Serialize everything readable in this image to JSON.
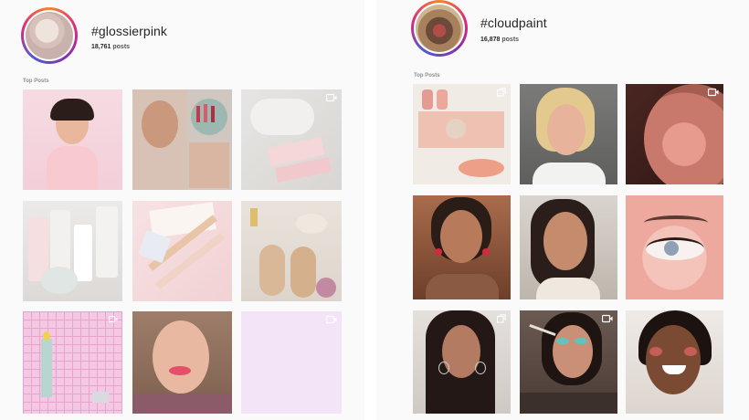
{
  "left": {
    "hashtag": "#glossierpink",
    "post_count": "18,761",
    "post_count_suffix": "posts",
    "section_label": "Top Posts",
    "avatar_icon": "avatar-photo",
    "tiles": [
      {
        "name": "post-1",
        "desc": "portrait-pink",
        "icon": "none"
      },
      {
        "name": "post-2",
        "desc": "lipstick-collage",
        "icon": "none"
      },
      {
        "name": "post-3",
        "desc": "product-packaging",
        "icon": "video-icon"
      },
      {
        "name": "post-4",
        "desc": "skincare-products",
        "icon": "none"
      },
      {
        "name": "post-5",
        "desc": "makeup-products",
        "icon": "none"
      },
      {
        "name": "post-6",
        "desc": "shoes-and-products",
        "icon": "none"
      },
      {
        "name": "post-7",
        "desc": "pink-grid-room",
        "icon": "video-icon"
      },
      {
        "name": "post-8",
        "desc": "woman-pink-lips",
        "icon": "none"
      },
      {
        "name": "post-9",
        "desc": "lavender-blank",
        "icon": "video-icon"
      }
    ]
  },
  "right": {
    "hashtag": "#cloudpaint",
    "post_count": "16,878",
    "post_count_suffix": "posts",
    "section_label": "Top Posts",
    "avatar_icon": "avatar-photo",
    "tiles": [
      {
        "name": "post-1",
        "desc": "glow-makeup-collage",
        "icon": "multi-icon"
      },
      {
        "name": "post-2",
        "desc": "blond-man-portrait",
        "icon": "none"
      },
      {
        "name": "post-3",
        "desc": "blush-closeup",
        "icon": "video-icon"
      },
      {
        "name": "post-4",
        "desc": "woman-red-earrings",
        "icon": "none"
      },
      {
        "name": "post-5",
        "desc": "woman-portrait",
        "icon": "none"
      },
      {
        "name": "post-6",
        "desc": "eyeliner-closeup",
        "icon": "none"
      },
      {
        "name": "post-7",
        "desc": "woman-hoop-earrings",
        "icon": "multi-icon"
      },
      {
        "name": "post-8",
        "desc": "makeup-application",
        "icon": "video-icon"
      },
      {
        "name": "post-9",
        "desc": "smiling-woman",
        "icon": "none"
      }
    ]
  },
  "colors": {
    "panel_bg": "#fafafa",
    "text_dark": "#262626",
    "text_muted": "#8e8e8e"
  }
}
